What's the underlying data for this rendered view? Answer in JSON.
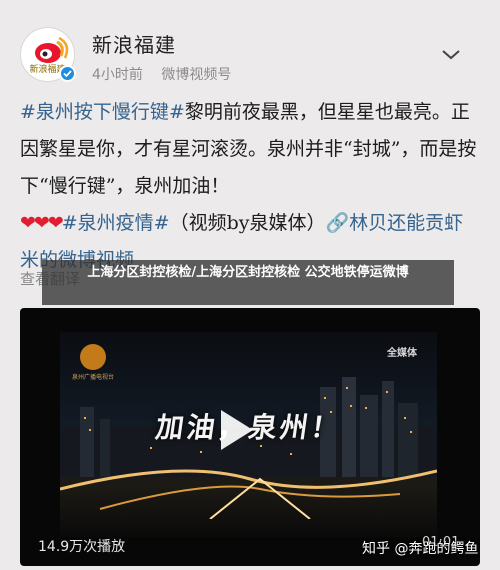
{
  "account": {
    "name": "新浪福建",
    "avatar_text": "新浪福建",
    "time": "4小时前",
    "source": "微博视频号"
  },
  "post": {
    "hashtag1": "#泉州按下慢行键#",
    "text1": "黎明前夜最黑，但星星也最亮。正因繁星是你，才有星河滚烫。泉州并非“封城”，而是按下“慢行键”，泉州加油！",
    "hearts": "❤❤❤",
    "hashtag2": "#泉州疫情#",
    "text2": "（视频by泉媒体）",
    "link": "🔗林贝还能贡虾米的微博视频",
    "translate": "查看翻译"
  },
  "banner": {
    "title": "上海分区封控核检/上海分区封控核检 公交地铁停运微博"
  },
  "video": {
    "slogan": "加油，泉州！",
    "logo_left": "泉州广播电视台",
    "logo_right": "全媒体",
    "views": "14.9万次播放",
    "duration": "01:01",
    "watermark": "知乎 @奔跑的鳄鱼"
  },
  "icons": {
    "verified": "verified-badge-icon",
    "more": "chevron-down-icon",
    "play": "play-icon",
    "link": "link-icon"
  },
  "colors": {
    "tag": "#36648e",
    "verified": "#1f8ddf",
    "hearts": "#e01e2f"
  }
}
